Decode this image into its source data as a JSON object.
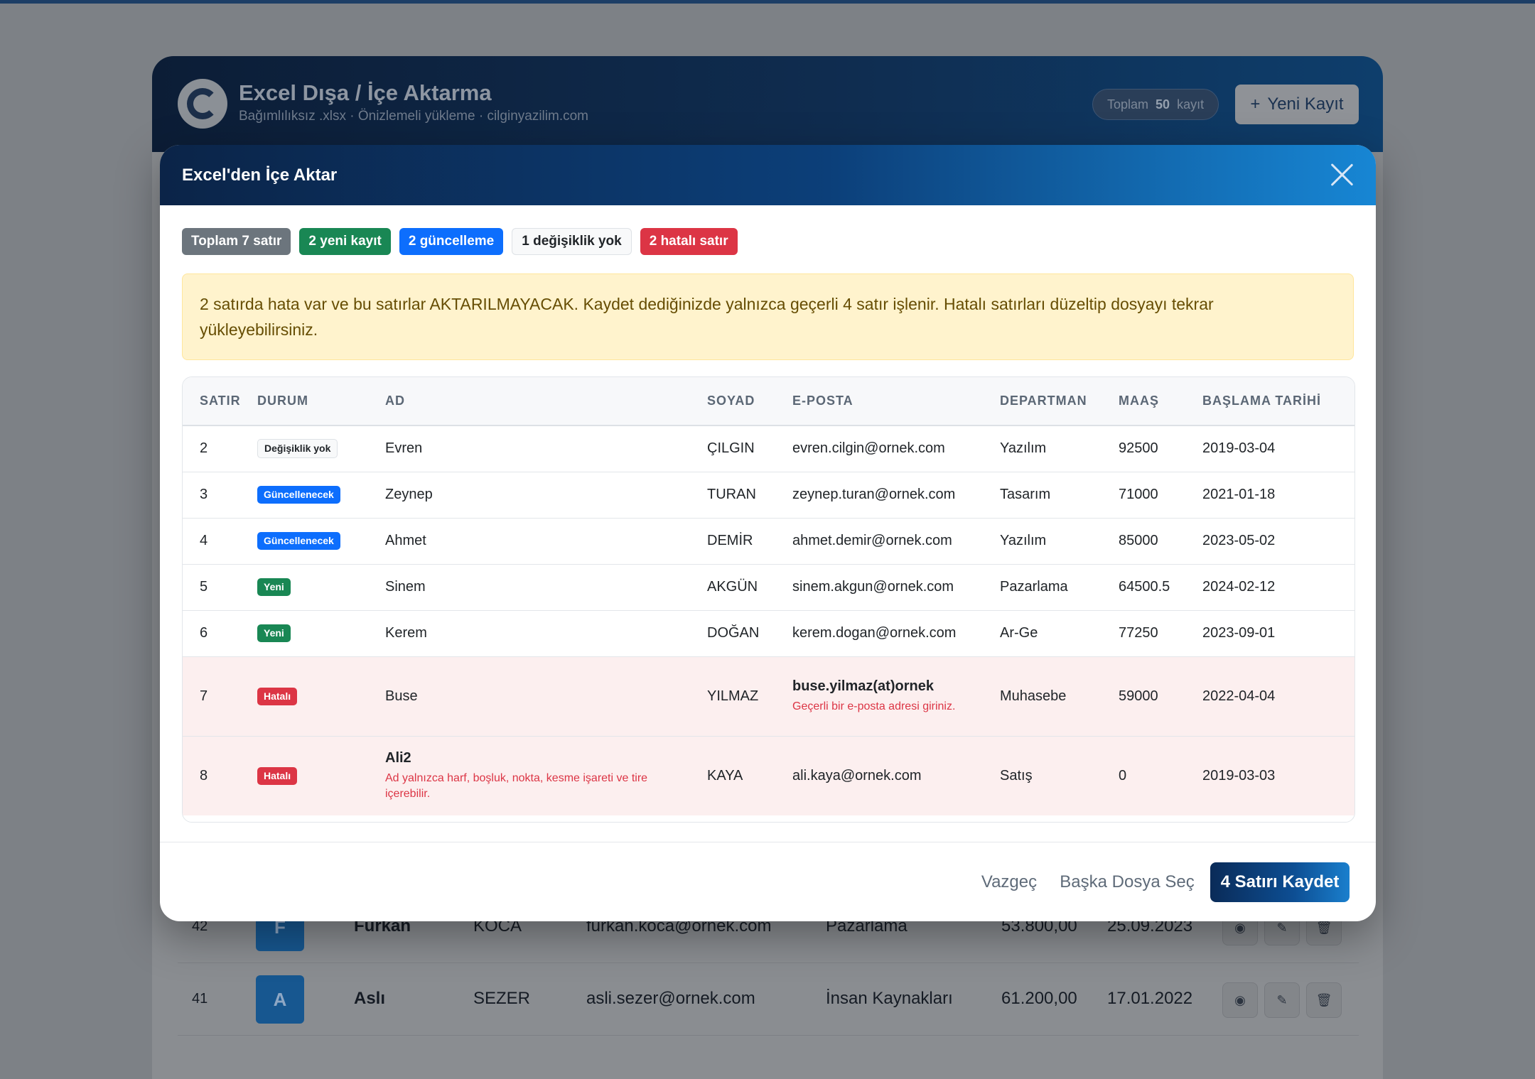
{
  "app": {
    "title": "Excel Dışa / İçe Aktarma",
    "subtitle": "Bağımlılıksız .xlsx · Önizlemeli yükleme · cilginyazilim.com",
    "count_prefix": "Toplam",
    "count_value": "50",
    "count_suffix": "kayıt",
    "new_button": "Yeni Kayıt",
    "rows": [
      {
        "no": "42",
        "initial": "F",
        "name": "Furkan",
        "surname": "KOCA",
        "email": "furkan.koca@ornek.com",
        "department": "Pazarlama",
        "salary": "53.800,00",
        "date": "25.09.2023"
      },
      {
        "no": "41",
        "initial": "A",
        "name": "Aslı",
        "surname": "SEZER",
        "email": "asli.sezer@ornek.com",
        "department": "İnsan Kaynakları",
        "salary": "61.200,00",
        "date": "17.01.2022"
      }
    ]
  },
  "modal": {
    "title": "Excel'den İçe Aktar",
    "badges": {
      "total": "Toplam 7 satır",
      "new": "2 yeni kayıt",
      "update": "2 güncelleme",
      "nochange": "1 değişiklik yok",
      "error": "2 hatalı satır"
    },
    "alert": "2 satırda hata var ve bu satırlar AKTARILMAYACAK. Kaydet dediğinizde yalnızca geçerli 4 satır işlenir. Hatalı satırları düzeltip dosyayı tekrar yükleyebilirsiniz.",
    "columns": [
      "SATIR",
      "DURUM",
      "AD",
      "SOYAD",
      "E-POSTA",
      "DEPARTMAN",
      "MAAŞ",
      "BAŞLAMA TARİHİ"
    ],
    "rows": [
      {
        "row": "2",
        "status": "Değişiklik yok",
        "name": "Evren",
        "surname": "ÇILGIN",
        "email": "evren.cilgin@ornek.com",
        "department": "Yazılım",
        "salary": "92500",
        "date": "2019-03-04"
      },
      {
        "row": "3",
        "status": "Güncellenecek",
        "name": "Zeynep",
        "surname": "TURAN",
        "email": "zeynep.turan@ornek.com",
        "department": "Tasarım",
        "salary": "71000",
        "date": "2021-01-18"
      },
      {
        "row": "4",
        "status": "Güncellenecek",
        "name": "Ahmet",
        "surname": "DEMİR",
        "email": "ahmet.demir@ornek.com",
        "department": "Yazılım",
        "salary": "85000",
        "date": "2023-05-02"
      },
      {
        "row": "5",
        "status": "Yeni",
        "name": "Sinem",
        "surname": "AKGÜN",
        "email": "sinem.akgun@ornek.com",
        "department": "Pazarlama",
        "salary": "64500.5",
        "date": "2024-02-12"
      },
      {
        "row": "6",
        "status": "Yeni",
        "name": "Kerem",
        "surname": "DOĞAN",
        "email": "kerem.dogan@ornek.com",
        "department": "Ar-Ge",
        "salary": "77250",
        "date": "2023-09-01"
      },
      {
        "row": "7",
        "status": "Hatalı",
        "name": "Buse",
        "surname": "YILMAZ",
        "email": "buse.yilmaz(at)ornek",
        "email_error": "Geçerli bir e-posta adresi giriniz.",
        "department": "Muhasebe",
        "salary": "59000",
        "date": "2022-04-04"
      },
      {
        "row": "8",
        "status": "Hatalı",
        "name": "Ali2",
        "name_error": "Ad yalnızca harf, boşluk, nokta, kesme işareti ve tire içerebilir.",
        "surname": "KAYA",
        "email": "ali.kaya@ornek.com",
        "department": "Satış",
        "salary": "0",
        "date": "2019-03-03"
      }
    ],
    "footer": {
      "cancel": "Vazgeç",
      "other_file": "Başka Dosya Seç",
      "save": "4 Satırı Kaydet"
    }
  }
}
